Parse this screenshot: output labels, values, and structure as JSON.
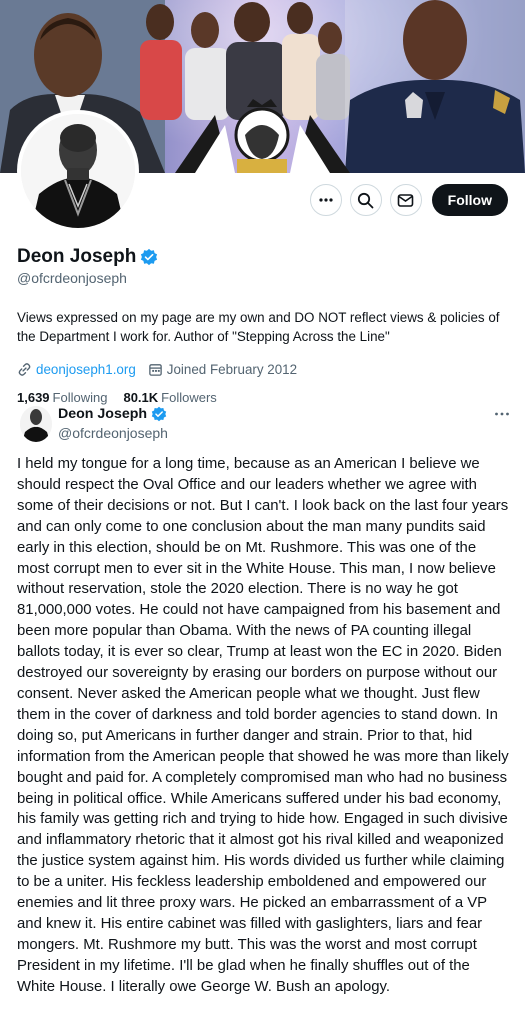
{
  "profile": {
    "display_name": "Deon Joseph",
    "handle": "@ofcrdeonjoseph",
    "bio": "Views expressed on my page are my own and DO NOT reflect views & policies of the Department I work for. Author of \"Stepping Across the Line\"",
    "website": "deonjoseph1.org",
    "joined": "Joined February 2012",
    "following_count": "1,639",
    "following_label": "Following",
    "followers_count": "80.1K",
    "followers_label": "Followers",
    "verified": true
  },
  "actions": {
    "more_icon": "more-icon",
    "search_icon": "search-icon",
    "message_icon": "mail-icon",
    "follow_label": "Follow"
  },
  "post": {
    "author_name": "Deon Joseph",
    "author_handle": "@ofcrdeonjoseph",
    "text": "I held my tongue for a long time, because as an American I believe we should respect the Oval Office and our leaders whether we agree with some of their decisions or not. But I can't. I look back on the last four years and can only come to one conclusion about the man many pundits said early in this election, should be on Mt. Rushmore. This was one of the most corrupt men to ever sit in the White House.  This man, I now believe without reservation, stole the 2020 election. There is no way he got 81,000,000 votes. He could not have campaigned from his basement and been more popular than Obama.  With the news of PA counting illegal ballots today, it is ever so clear, Trump at least won the EC in 2020. Biden destroyed our sovereignty by erasing our borders on purpose without our consent. Never asked the American people what we thought. Just flew them in the cover of darkness and told border agencies to stand down.  In doing so, put Americans in further danger and strain.  Prior to that, hid information from the American people that showed he was more than likely bought and paid for. A completely compromised man who had no business being in political office. While Americans suffered under his bad economy, his family was getting rich and trying to hide how. Engaged in such divisive and inflammatory rhetoric that it almost got his rival killed and weaponized the justice system against him. His words divided us further while claiming to be a uniter. His feckless leadership emboldened and empowered our enemies and lit three proxy wars. He picked an embarrassment of a VP and knew it.  His entire cabinet was filled with gaslighters, liars and fear mongers. Mt. Rushmore my butt. This was the worst and most corrupt President in my lifetime.  I'll be glad when he finally shuffles out of the White House. I literally owe George W. Bush an apology."
  },
  "colors": {
    "verified_badge": "#1d9bf0",
    "link": "#1d9bf0",
    "secondary_text": "#536471",
    "follow_bg": "#0f1419"
  }
}
